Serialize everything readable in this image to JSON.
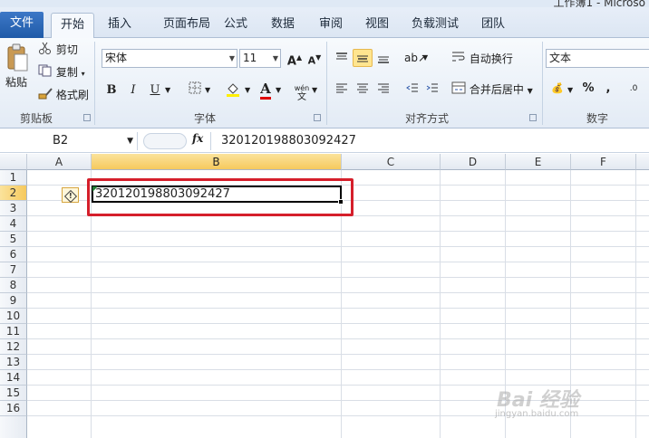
{
  "window": {
    "title_partial": "工作簿1 - Microso"
  },
  "tabs": [
    "文件",
    "开始",
    "插入",
    "页面布局",
    "公式",
    "数据",
    "审阅",
    "视图",
    "负载测试",
    "团队"
  ],
  "clipboard": {
    "paste": "粘贴",
    "cut": "剪切",
    "copy": "复制",
    "format_painter": "格式刷",
    "label": "剪贴板"
  },
  "font": {
    "name": "宋体",
    "size": "11",
    "label": "字体",
    "bold": "B",
    "italic": "I",
    "underline": "U",
    "phonetic": "wén"
  },
  "alignment": {
    "wrap": "自动换行",
    "merge": "合并后居中",
    "label": "对齐方式"
  },
  "number": {
    "format": "文本",
    "percent": "%",
    "comma": ",",
    "label": "数字"
  },
  "formula_bar": {
    "name_box": "B2",
    "fx": "fx",
    "content": "320120198803092427"
  },
  "columns": [
    "A",
    "B",
    "C",
    "D",
    "E",
    "F"
  ],
  "rows": [
    "1",
    "2",
    "3",
    "4",
    "5",
    "6",
    "7",
    "8",
    "9",
    "10",
    "11",
    "12",
    "13",
    "14",
    "15",
    "16"
  ],
  "cell_b2": "320120198803092427",
  "warning_icon": "!",
  "selected_cell": "B2",
  "watermark": {
    "text": "Bai 经验",
    "url": "jingyan.baidu.com"
  },
  "colors": {
    "selection_header": "#f6c95d",
    "highlight_box": "#d51f2b",
    "file_tab": "#2a66b8"
  }
}
